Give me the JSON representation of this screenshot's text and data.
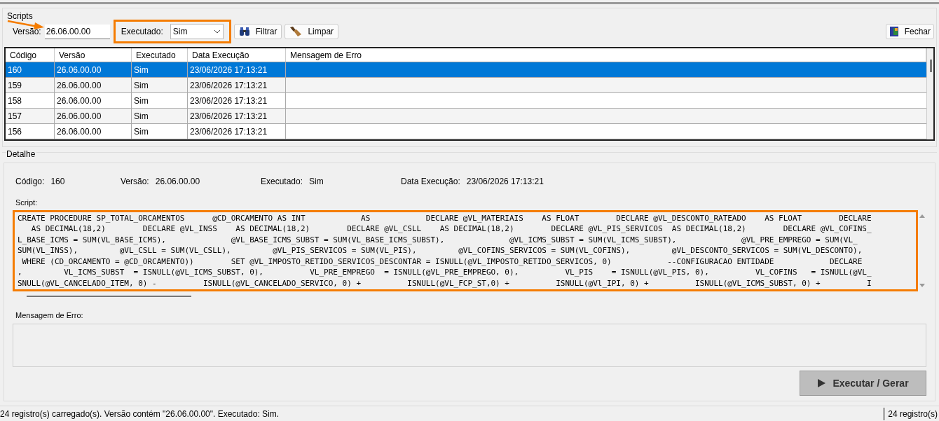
{
  "scripts_group": {
    "title": "Scripts"
  },
  "filter": {
    "version_label": "Versão:",
    "version_value": "26.06.00.00",
    "executed_label": "Executado:",
    "executed_value": "Sim"
  },
  "buttons": [
    {
      "kind": "filter",
      "label": "Filtrar"
    },
    {
      "kind": "clear",
      "label": "Limpar"
    }
  ],
  "close_button": {
    "label": "Fechar"
  },
  "table": {
    "columns": [
      "Código",
      "Versão",
      "Executado",
      "Data Execução",
      "Mensagem de Erro"
    ],
    "rows": [
      {
        "cells": [
          "160",
          "26.06.00.00",
          "Sim",
          "23/06/2026 17:13:21",
          ""
        ],
        "selected": true
      },
      {
        "cells": [
          "159",
          "26.06.00.00",
          "Sim",
          "23/06/2026 17:13:21",
          ""
        ],
        "selected": false
      },
      {
        "cells": [
          "158",
          "26.06.00.00",
          "Sim",
          "23/06/2026 17:13:21",
          ""
        ],
        "selected": false
      },
      {
        "cells": [
          "157",
          "26.06.00.00",
          "Sim",
          "23/06/2026 17:13:21",
          ""
        ],
        "selected": false
      },
      {
        "cells": [
          "156",
          "26.06.00.00",
          "Sim",
          "23/06/2026 17:13:21",
          ""
        ],
        "selected": false
      }
    ]
  },
  "detail_group": {
    "title": "Detalhe"
  },
  "detail_fields": [
    {
      "label": "Código:",
      "value": "160"
    },
    {
      "label": "Versão:",
      "value": "26.06.00.00"
    },
    {
      "label": "Executado:",
      "value": "Sim"
    },
    {
      "label": "Data Execução:",
      "value": "23/06/2026 17:13:21"
    }
  ],
  "script": {
    "label": "Script:",
    "lines": [
      "CREATE PROCEDURE SP_TOTAL_ORCAMENTOS      @CD_ORCAMENTO AS INT            AS            DECLARE @VL_MATERIAIS    AS FLOAT        DECLARE @VL_DESCONTO_RATEADO    AS FLOAT        DECLARE",
      "   AS DECIMAL(18,2)        DECLARE @VL_INSS    AS DECIMAL(18,2)        DECLARE @VL_CSLL    AS DECIMAL(18,2)        DECLARE @VL_PIS_SERVICOS  AS DECIMAL(18,2)        DECLARE @VL_COFINS_",
      "L_BASE_ICMS = SUM(VL_BASE_ICMS),              @VL_BASE_ICMS_SUBST = SUM(VL_BASE_ICMS_SUBST),              @VL_ICMS_SUBST = SUM(VL_ICMS_SUBST),              @VL_PRE_EMPREGO = SUM(VL_",
      "SUM(VL_INSS),         @VL_CSLL = SUM(VL_CSLL),         @VL_PIS_SERVICOS = SUM(VL_PIS),         @VL_COFINS_SERVICOS = SUM(VL_COFINS),         @VL_DESCONTO_SERVICOS = SUM(VL_DESCONTO),",
      " WHERE (CD_ORCAMENTO = @CD_ORCAMENTO))        SET @VL_IMPOSTO_RETIDO_SERVICOS_DESCONTAR = ISNULL(@VL_IMPOSTO_RETIDO_SERVICOS, 0)            --CONFIGURACAO ENTIDADE            DECLARE",
      ",         VL_ICMS_SUBST  = ISNULL(@VL_ICMS_SUBST, 0),          VL_PRE_EMPREGO  = ISNULL(@VL_PRE_EMPREGO, 0),          VL_PIS    = ISNULL(@VL_PIS, 0),          VL_COFINS   = ISNULL(@VL_",
      "SNULL(@VL_CANCELADO_ITEM, 0) -          ISNULL(@VL_CANCELADO_SERVICO, 0) +          ISNULL(@VL_FCP_ST,0) +          ISNULL(@Vl_IPI, 0) +          ISNULL(@VL_ICMS_SUBST, 0) +          I"
    ]
  },
  "error_message": {
    "label": "Mensagem de Erro:"
  },
  "run_button": {
    "label": "Executar / Gerar",
    "disabled": true
  },
  "status_bar": {
    "message": "24 registro(s) carregado(s). Versão contém \"26.06.00.00\". Executado: Sim.",
    "count": "24 registro(s)"
  }
}
